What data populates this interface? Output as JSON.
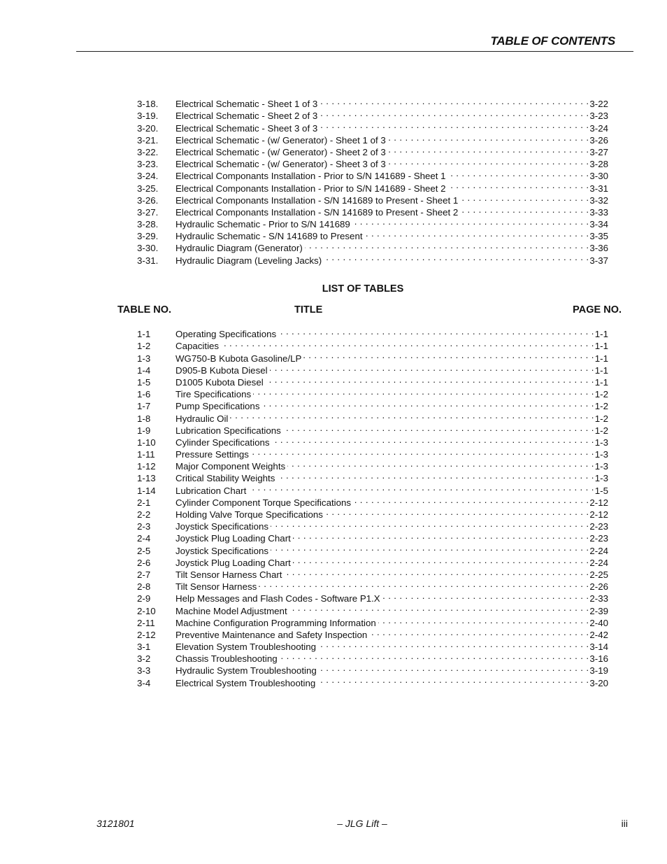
{
  "header": {
    "title": "TABLE OF CONTENTS"
  },
  "figures": [
    {
      "num": "3-18.",
      "title": "Electrical Schematic - Sheet 1 of 3",
      "page": "3-22"
    },
    {
      "num": "3-19.",
      "title": "Electrical Schematic - Sheet 2 of 3",
      "page": "3-23"
    },
    {
      "num": "3-20.",
      "title": "Electrical Schematic - Sheet 3 of 3",
      "page": "3-24"
    },
    {
      "num": "3-21.",
      "title": "Electrical Schematic - (w/ Generator) - Sheet 1 of 3",
      "page": "3-26"
    },
    {
      "num": "3-22.",
      "title": "Electrical Schematic - (w/ Generator) - Sheet 2 of 3",
      "page": "3-27"
    },
    {
      "num": "3-23.",
      "title": "Electrical Schematic - (w/ Generator) - Sheet 3 of 3",
      "page": "3-28"
    },
    {
      "num": "3-24.",
      "title": "Electrical Componants Installation - Prior to S/N 141689 - Sheet 1",
      "page": "3-30"
    },
    {
      "num": "3-25.",
      "title": "Electrical Componants Installation - Prior to S/N 141689 - Sheet 2",
      "page": "3-31"
    },
    {
      "num": "3-26.",
      "title": "Electrical Componants Installation - S/N 141689 to Present - Sheet 1",
      "page": "3-32"
    },
    {
      "num": "3-27.",
      "title": "Electrical Componants Installation - S/N 141689 to Present - Sheet 2",
      "page": "3-33"
    },
    {
      "num": "3-28.",
      "title": "Hydraulic Schematic - Prior to S/N 141689",
      "page": "3-34"
    },
    {
      "num": "3-29.",
      "title": "Hydraulic Schematic - S/N 141689 to Present",
      "page": "3-35"
    },
    {
      "num": "3-30.",
      "title": "Hydraulic Diagram (Generator)",
      "page": "3-36"
    },
    {
      "num": "3-31.",
      "title": "Hydraulic Diagram (Leveling Jacks)",
      "page": "3-37"
    }
  ],
  "tables_section": {
    "title": "LIST OF TABLES",
    "col_table_no": "TABLE NO.",
    "col_title": "TITLE",
    "col_page_no": "PAGE NO."
  },
  "tables": [
    {
      "num": "1-1",
      "title": "Operating Specifications",
      "page": "1-1"
    },
    {
      "num": "1-2",
      "title": "Capacities",
      "page": "1-1"
    },
    {
      "num": "1-3",
      "title": "WG750-B Kubota Gasoline/LP",
      "page": "1-1"
    },
    {
      "num": "1-4",
      "title": "D905-B Kubota Diesel",
      "page": "1-1"
    },
    {
      "num": "1-5",
      "title": "D1005 Kubota Diesel",
      "page": "1-1"
    },
    {
      "num": "1-6",
      "title": "Tire Specifications",
      "page": "1-2"
    },
    {
      "num": "1-7",
      "title": "Pump Specifications",
      "page": "1-2"
    },
    {
      "num": "1-8",
      "title": "Hydraulic Oil",
      "page": "1-2"
    },
    {
      "num": "1-9",
      "title": "Lubrication Specifications",
      "page": "1-2"
    },
    {
      "num": "1-10",
      "title": "Cylinder Specifications",
      "page": "1-3"
    },
    {
      "num": "1-11",
      "title": "Pressure Settings",
      "page": "1-3"
    },
    {
      "num": "1-12",
      "title": "Major Component Weights",
      "page": "1-3"
    },
    {
      "num": "1-13",
      "title": "Critical Stability Weights",
      "page": "1-3"
    },
    {
      "num": "1-14",
      "title": "Lubrication Chart",
      "page": "1-5"
    },
    {
      "num": "2-1",
      "title": "Cylinder Component Torque Specifications",
      "page": "2-12"
    },
    {
      "num": "2-2",
      "title": "Holding Valve Torque Specifications",
      "page": "2-12"
    },
    {
      "num": "2-3",
      "title": "Joystick Specifications",
      "page": "2-23"
    },
    {
      "num": "2-4",
      "title": "Joystick Plug Loading Chart",
      "page": "2-23"
    },
    {
      "num": "2-5",
      "title": "Joystick Specifications",
      "page": "2-24"
    },
    {
      "num": "2-6",
      "title": "Joystick Plug Loading Chart",
      "page": "2-24"
    },
    {
      "num": "2-7",
      "title": "Tilt Sensor Harness Chart",
      "page": "2-25"
    },
    {
      "num": "2-8",
      "title": "Tilt Sensor Harness",
      "page": "2-26"
    },
    {
      "num": "2-9",
      "title": "Help Messages and Flash Codes - Software P1.X",
      "page": "2-33"
    },
    {
      "num": "2-10",
      "title": "Machine Model Adjustment",
      "page": "2-39"
    },
    {
      "num": "2-11",
      "title": "Machine Configuration Programming Information",
      "page": "2-40"
    },
    {
      "num": "2-12",
      "title": "Preventive Maintenance and Safety Inspection",
      "page": "2-42"
    },
    {
      "num": "3-1",
      "title": "Elevation System Troubleshooting",
      "page": "3-14"
    },
    {
      "num": "3-2",
      "title": "Chassis Troubleshooting",
      "page": "3-16"
    },
    {
      "num": "3-3",
      "title": "Hydraulic System Troubleshooting",
      "page": "3-19"
    },
    {
      "num": "3-4",
      "title": "Electrical System Troubleshooting",
      "page": "3-20"
    }
  ],
  "footer": {
    "doc_number": "3121801",
    "brand": "– JLG Lift –",
    "page": "iii"
  }
}
